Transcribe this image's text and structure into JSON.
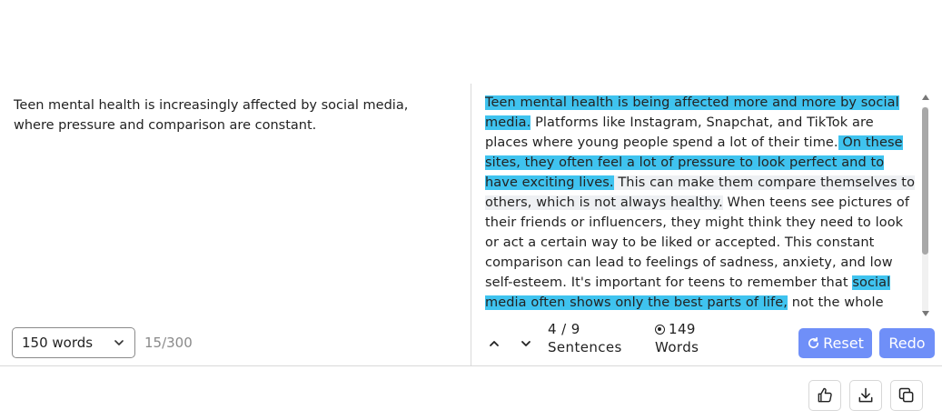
{
  "input": {
    "text": "Teen mental health is increasingly affected by social media, where pressure and comparison are constant.",
    "length_select": "150 words",
    "char_count": "15/300"
  },
  "output": {
    "seg1": "Teen mental health is being affected more and more by social media.",
    "seg2": " Platforms like Instagram, Snapchat, and TikTok are places where young people spend a lot of their time.",
    "seg3": " On these sites, they often feel a lot of pressure to look perfect and to have exciting lives.",
    "seg4": " This can make them compare themselves to others, which is not always healthy.",
    "seg5": " When teens see pictures of their friends or influencers, they might think they need to look or act a certain way to be liked or accepted. This constant comparison can lead to feelings of sadness, anxiety, and low self-esteem. It's important for teens to remember that ",
    "seg6": "social media often shows only the best parts of life,",
    "seg7": " not the whole story. Finding a balance between online and real life",
    "highlight_color": "#3fc3ef"
  },
  "stats": {
    "sentences_value": "4 / 9",
    "sentences_label": "Sentences",
    "words_value": "149",
    "words_label": "Words"
  },
  "buttons": {
    "reset": "Reset",
    "redo": "Redo",
    "accent_color": "#6f8ff8"
  },
  "footer": {
    "icons": [
      "thumbs-up-icon",
      "download-icon",
      "copy-icon"
    ]
  }
}
